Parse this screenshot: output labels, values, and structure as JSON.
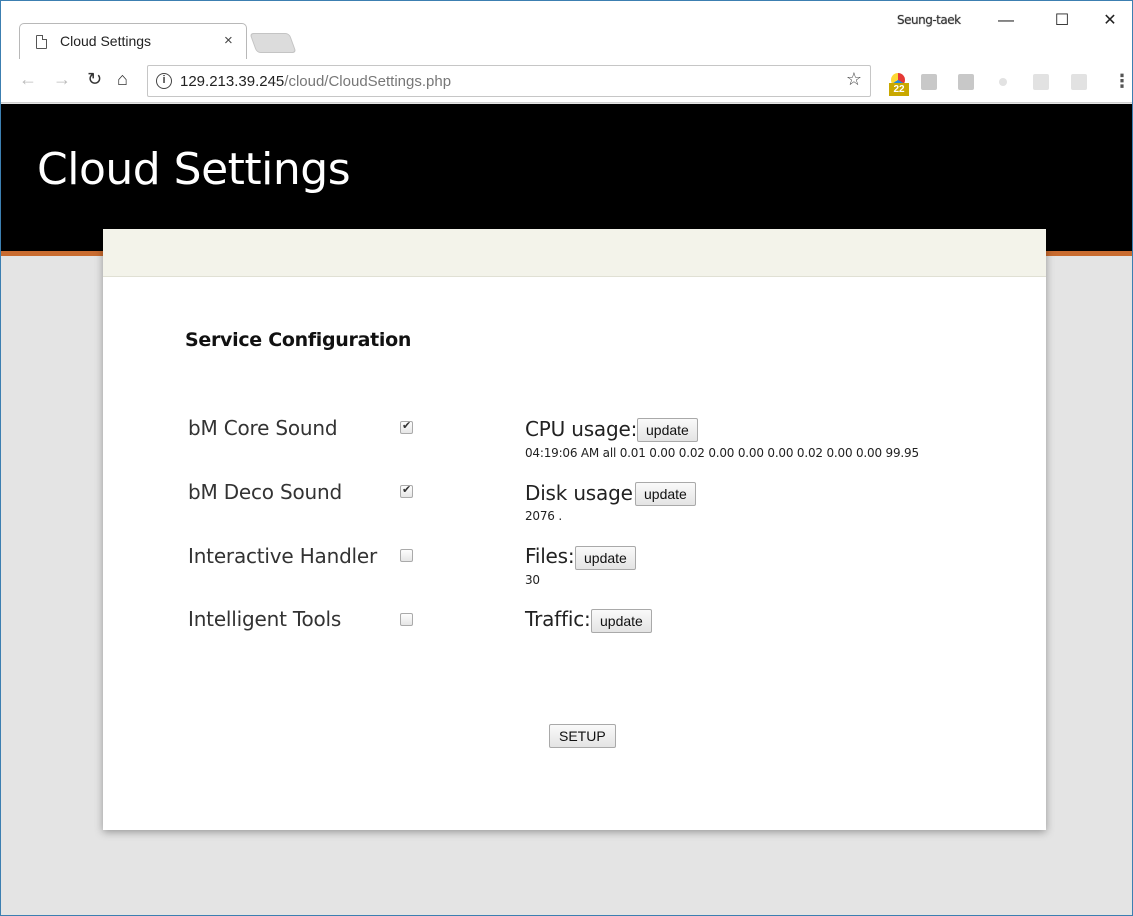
{
  "browser": {
    "tab_title": "Cloud Settings",
    "tab_close": "×",
    "profile_name": "Seung-taek",
    "window_controls": {
      "minimize": "—",
      "maximize": "☐",
      "close": "✕"
    },
    "url_host": "129.213.39.245",
    "url_path": "/cloud/CloudSettings.php",
    "extension_badge": "22",
    "extensions": [
      "I",
      "T"
    ]
  },
  "page": {
    "title": "Cloud Settings",
    "section_title": "Service Configuration",
    "services": [
      {
        "label": "bM Core Sound",
        "checked": true
      },
      {
        "label": "bM Deco Sound",
        "checked": true
      },
      {
        "label": "Interactive Handler",
        "checked": false
      },
      {
        "label": "Intelligent Tools",
        "checked": false
      }
    ],
    "metrics": [
      {
        "label": "CPU usage:",
        "button": "update",
        "value": "04:19:06 AM all 0.01 0.00 0.02 0.00 0.00 0.00 0.02 0.00 0.00 99.95"
      },
      {
        "label": "Disk usage:",
        "button": "update",
        "value": "2076 ."
      },
      {
        "label": "Files:",
        "button": "update",
        "value": "30"
      },
      {
        "label": "Traffic:",
        "button": "update",
        "value": ""
      }
    ],
    "setup_button": "SETUP"
  },
  "colors": {
    "header_bg": "#000000",
    "accent_stripe": "#c96b2f",
    "card_header": "#f3f3ea",
    "page_bg": "#e4e4e4"
  }
}
